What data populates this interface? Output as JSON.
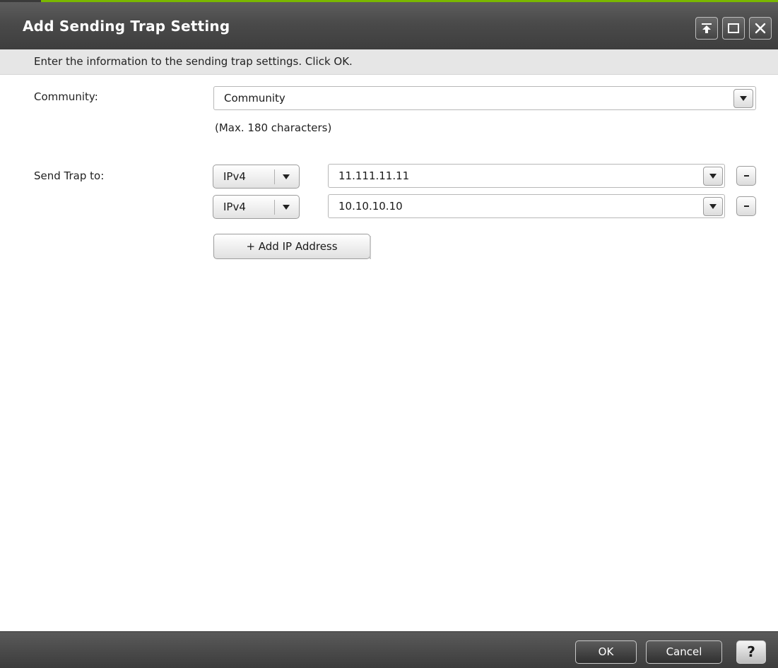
{
  "dialog": {
    "title": "Add Sending Trap Setting",
    "instruction": "Enter the information to the sending trap settings. Click OK."
  },
  "window_controls": [
    {
      "icon": "pin-top-icon"
    },
    {
      "icon": "maximize-icon"
    },
    {
      "icon": "close-icon"
    }
  ],
  "community": {
    "label": "Community:",
    "value": "Community",
    "hint": "(Max. 180 characters)"
  },
  "send_trap": {
    "label": "Send Trap to:",
    "rows": [
      {
        "version": "IPv4",
        "address": "11.111.11.11",
        "remove_label": "-"
      },
      {
        "version": "IPv4",
        "address": "10.10.10.10",
        "remove_label": "-"
      }
    ],
    "add_button": "+ Add IP Address"
  },
  "footer": {
    "ok": "OK",
    "cancel": "Cancel",
    "help": "?"
  },
  "colors": {
    "title_bar": "#4a4a4a",
    "accent_top": "#7ab800",
    "instruction_bg": "#e6e6e6"
  }
}
